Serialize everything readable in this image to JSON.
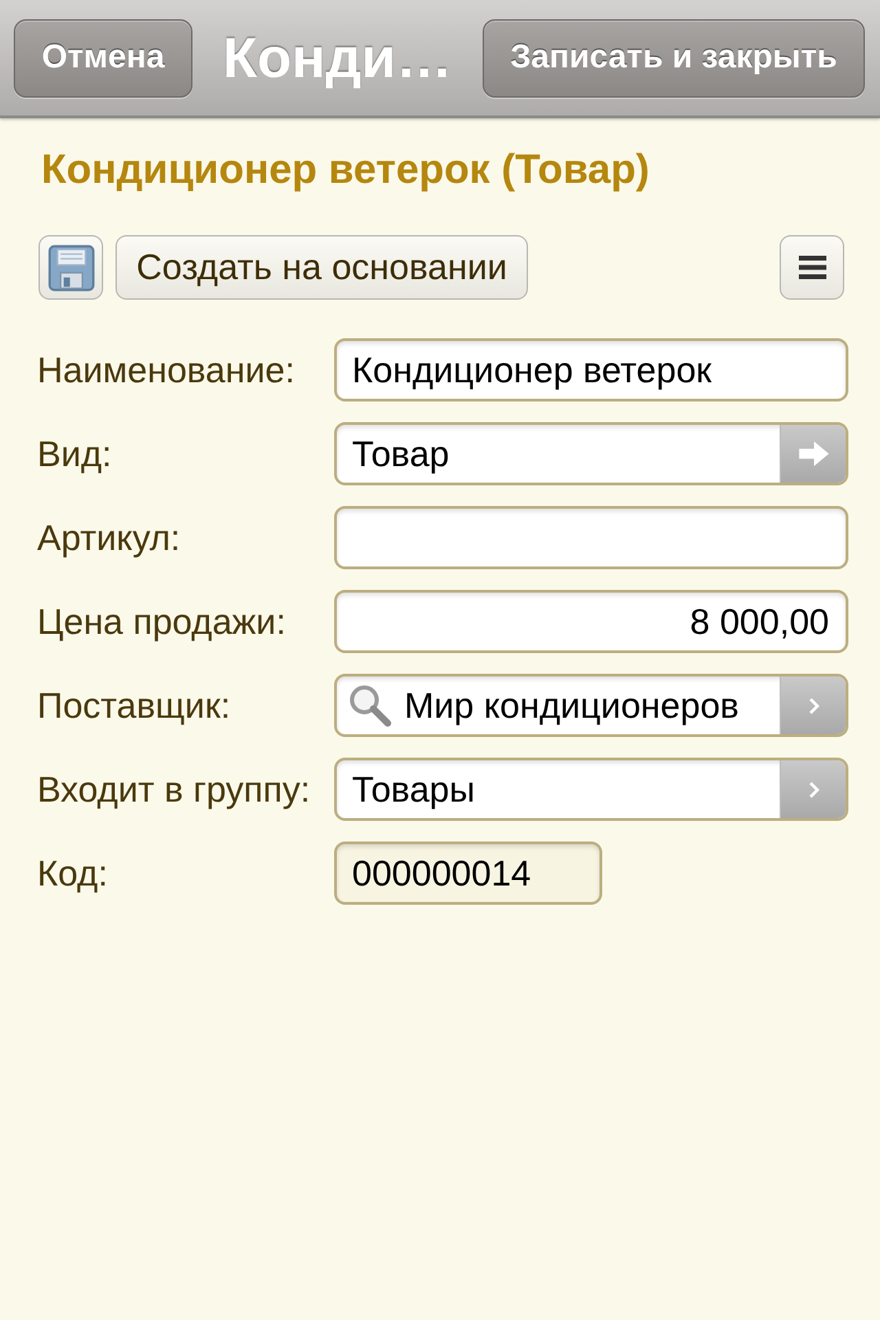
{
  "nav_bar": {
    "cancel_button": "Отмена",
    "title": "Конди…",
    "save_close_button": "Записать и закрыть"
  },
  "form_title": "Кондиционер ветерок (Товар)",
  "toolbar": {
    "create_based_on_button": "Создать на основании"
  },
  "fields": [
    {
      "kind": "text",
      "label": "Наименование:",
      "value": "Кондиционер ветерок"
    },
    {
      "kind": "open",
      "label": "Вид:",
      "value": "Товар"
    },
    {
      "kind": "text",
      "label": "Артикул:"
    },
    {
      "kind": "number",
      "label": "Цена продажи:",
      "value": "8 000,00"
    },
    {
      "kind": "lookup",
      "label": "Поставщик:",
      "value": "Мир кондиционеров"
    },
    {
      "kind": "choice",
      "label": "Входит в группу:",
      "value": "Товары"
    },
    {
      "kind": "readonly",
      "label": "Код:",
      "value": "000000014"
    }
  ]
}
